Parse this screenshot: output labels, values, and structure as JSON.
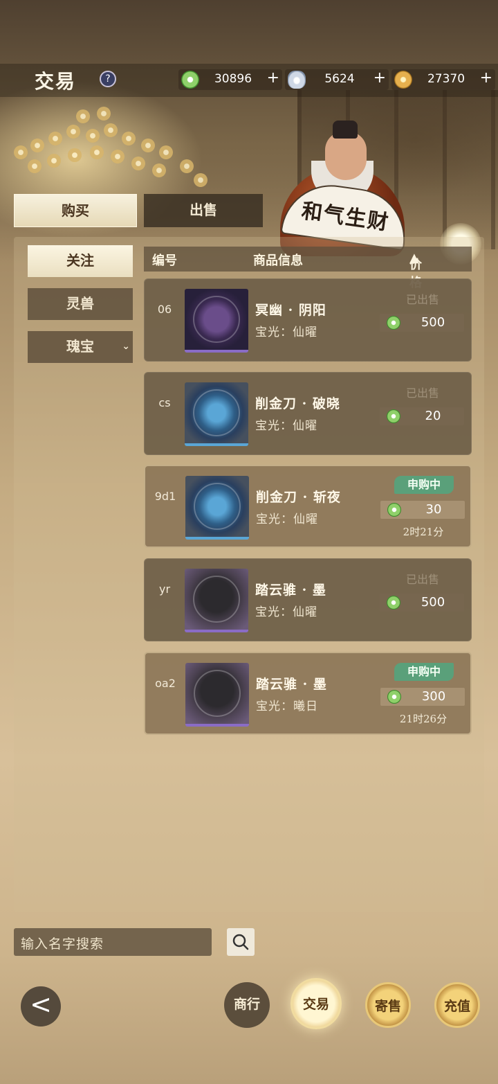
{
  "header": {
    "title": "交易",
    "help": "?",
    "currencies": [
      {
        "icon": "jade-coin-icon",
        "value": "30896",
        "plus": "+"
      },
      {
        "icon": "silver-ingot-icon",
        "value": "5624",
        "plus": "+"
      },
      {
        "icon": "gold-coin-icon",
        "value": "27370",
        "plus": "+"
      }
    ]
  },
  "merchant_fan_text": "和气生财",
  "tabs": {
    "buy": "购买",
    "sell": "出售"
  },
  "sidebar": {
    "items": [
      {
        "label": "关注"
      },
      {
        "label": "灵兽"
      },
      {
        "label": "瑰宝"
      }
    ]
  },
  "columns": {
    "code": "编号",
    "info": "商品信息",
    "price": "价格"
  },
  "listings": [
    {
      "code": "06",
      "name": "冥幽 · 阴阳",
      "sub": "宝光：仙曜",
      "status": "已出售",
      "price": "500",
      "time": ""
    },
    {
      "code": "cs",
      "name": "削金刀 · 破晓",
      "sub": "宝光：仙曜",
      "status": "已出售",
      "price": "20",
      "time": ""
    },
    {
      "code": "9d1",
      "name": "削金刀 · 斩夜",
      "sub": "宝光：仙曜",
      "status": "申购中",
      "price": "30",
      "time": "2时21分"
    },
    {
      "code": "yr",
      "name": "踏云骓 · 墨",
      "sub": "宝光：仙曜",
      "status": "已出售",
      "price": "500",
      "time": ""
    },
    {
      "code": "oa2",
      "name": "踏云骓 · 墨",
      "sub": "宝光：曦日",
      "status": "申购中",
      "price": "300",
      "time": "21时26分"
    }
  ],
  "search": {
    "placeholder": "输入名字搜索"
  },
  "bottom_nav": {
    "back": "<",
    "items": [
      {
        "label": "商行"
      },
      {
        "label": "交易"
      },
      {
        "label": "寄售"
      },
      {
        "label": "充值"
      }
    ]
  }
}
